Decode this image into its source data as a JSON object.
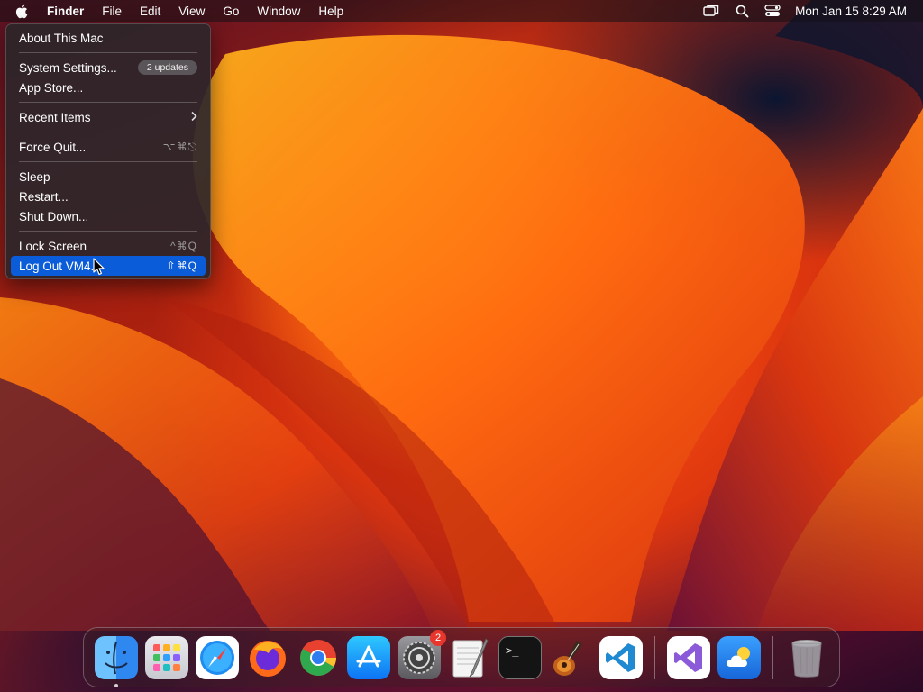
{
  "menubar": {
    "app_name": "Finder",
    "menus": [
      "File",
      "Edit",
      "View",
      "Go",
      "Window",
      "Help"
    ],
    "clock": "Mon Jan 15  8:29 AM",
    "status_icons": [
      "screen-mirroring-icon",
      "search-icon",
      "control-center-icon"
    ]
  },
  "apple_menu": {
    "about": "About This Mac",
    "system_settings": "System Settings...",
    "system_settings_badge": "2 updates",
    "app_store": "App Store...",
    "recent_items": "Recent Items",
    "force_quit": "Force Quit...",
    "force_quit_shortcut": "⌥⌘⎋",
    "sleep": "Sleep",
    "restart": "Restart...",
    "shut_down": "Shut Down...",
    "lock_screen": "Lock Screen",
    "lock_screen_shortcut": "^⌘Q",
    "log_out": "Log Out VM4...",
    "log_out_shortcut": "⇧⌘Q",
    "selected_item": "Log Out VM4..."
  },
  "dock": {
    "apps": [
      {
        "name": "Finder",
        "icon": "finder-icon",
        "running": true
      },
      {
        "name": "Launchpad",
        "icon": "launchpad-icon"
      },
      {
        "name": "Safari",
        "icon": "safari-icon"
      },
      {
        "name": "Firefox",
        "icon": "firefox-icon"
      },
      {
        "name": "Google Chrome",
        "icon": "chrome-icon"
      },
      {
        "name": "App Store",
        "icon": "app-store-icon"
      },
      {
        "name": "System Settings",
        "icon": "system-settings-icon",
        "badge": "2"
      },
      {
        "name": "TextEdit",
        "icon": "textedit-icon"
      },
      {
        "name": "Terminal",
        "icon": "terminal-icon"
      },
      {
        "name": "GarageBand",
        "icon": "garageband-icon"
      },
      {
        "name": "Visual Studio Code",
        "icon": "vscode-icon"
      },
      {
        "name": "Visual Studio",
        "icon": "visual-studio-icon"
      },
      {
        "name": "Weather",
        "icon": "weather-icon"
      },
      {
        "name": "Trash",
        "icon": "trash-icon"
      }
    ]
  },
  "colors": {
    "selection": "#0a5cd8",
    "badge_red": "#e8362c"
  }
}
